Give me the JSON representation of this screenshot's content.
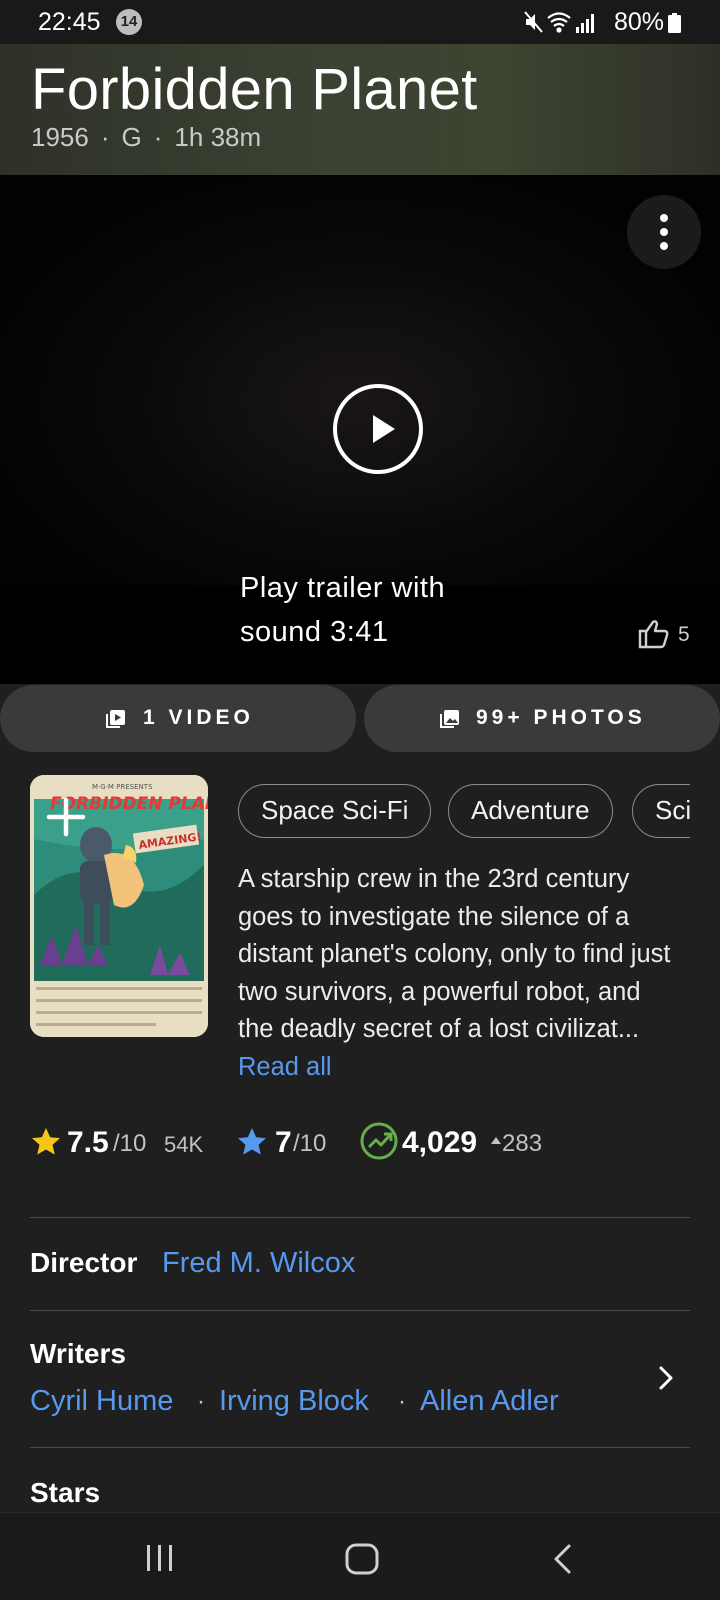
{
  "status_bar": {
    "time": "22:45",
    "notification_count": "14",
    "battery": "80%"
  },
  "movie": {
    "title": "Forbidden Planet",
    "year": "1956",
    "rating": "G",
    "runtime": "1h 38m",
    "meta_separator": "·"
  },
  "trailer": {
    "text": "Play trailer with sound  3:41",
    "likes": "5"
  },
  "media": {
    "videos_label": "1 VIDEO",
    "photos_label": "99+ PHOTOS"
  },
  "genres": [
    "Space Sci-Fi",
    "Adventure",
    "Sci-Fi"
  ],
  "plot": {
    "text": "A starship crew in the 23rd century goes to investigate the silence of a distant planet's colony, only to find just two survivors, a powerful robot, and the deadly secret of a lost civilizat...",
    "read_all": "Read all"
  },
  "ratings": {
    "imdb_score": "7.5",
    "imdb_out_of": "/10",
    "imdb_votes": "54K",
    "user_score": "7",
    "user_out_of": "/10",
    "popularity": "4,029",
    "popularity_change": "283"
  },
  "credits": {
    "director_label": "Director",
    "director": "Fred M. Wilcox",
    "writers_label": "Writers",
    "writers": [
      "Cyril Hume",
      "Irving Block",
      "Allen Adler"
    ],
    "writer_separator": "·",
    "stars_label": "Stars"
  },
  "colors": {
    "link": "#5799ef",
    "star_gold": "#f5c518",
    "star_blue": "#5799ef",
    "trend_green": "#67ad4b"
  },
  "icons": {
    "kebab": "more-vertical-icon",
    "play": "play-icon",
    "like": "thumbs-up-icon",
    "video": "video-library-icon",
    "photos": "photo-library-icon",
    "add": "plus-icon",
    "imdb_star": "star-icon",
    "user_star": "star-outline-icon",
    "trend": "trending-up-icon",
    "chevron": "chevron-right-icon"
  }
}
